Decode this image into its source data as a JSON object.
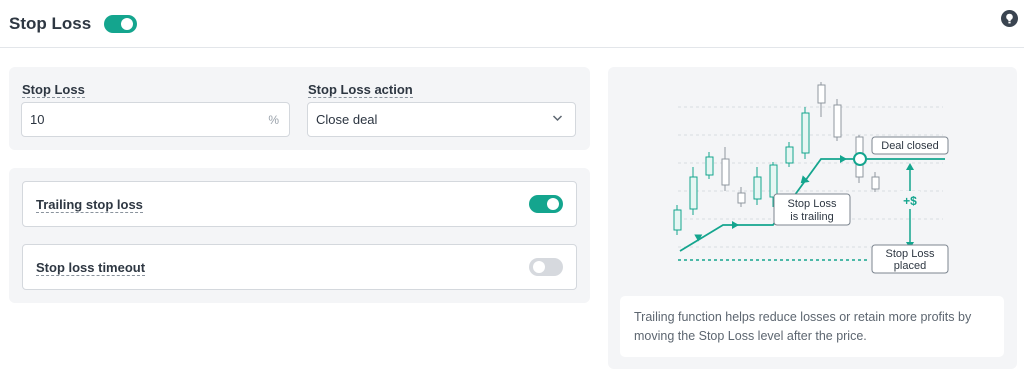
{
  "header": {
    "title": "Stop Loss",
    "enabled": true
  },
  "stop_loss": {
    "label": "Stop Loss",
    "value": "10",
    "unit": "%"
  },
  "action": {
    "label": "Stop Loss action",
    "value": "Close deal"
  },
  "trailing": {
    "label": "Trailing stop loss",
    "enabled": true
  },
  "timeout": {
    "label": "Stop loss timeout",
    "enabled": false
  },
  "illustration": {
    "deal_closed": "Deal closed",
    "trailing_line1": "Stop Loss",
    "trailing_line2": "is trailing",
    "profit": "+$",
    "placed_line1": "Stop Loss",
    "placed_line2": "placed"
  },
  "description": "Trailing function helps reduce losses or retain more profits by moving the Stop Loss level after the price.",
  "colors": {
    "accent": "#14a58e",
    "panel": "#f4f5f7"
  }
}
